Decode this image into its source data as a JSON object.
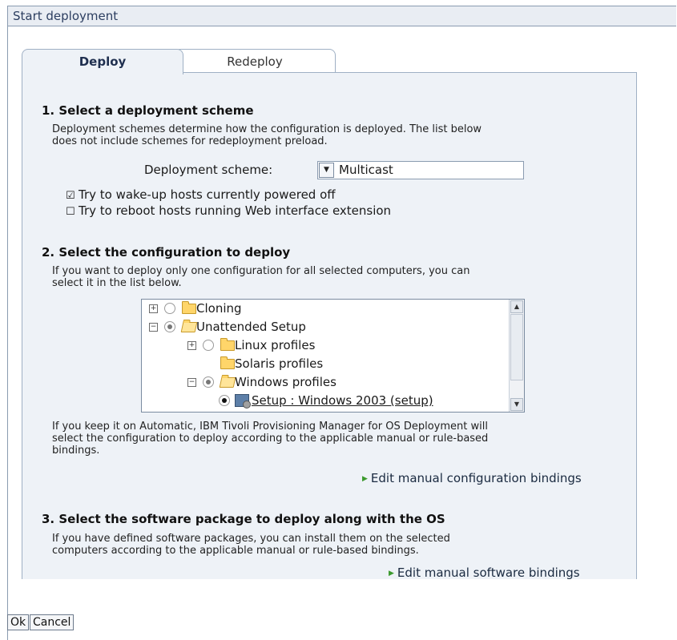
{
  "window": {
    "title": "Start deployment"
  },
  "tabs": [
    {
      "label": "Deploy",
      "active": true
    },
    {
      "label": "Redeploy",
      "active": false
    }
  ],
  "section1": {
    "title": "1. Select a deployment scheme",
    "desc_line1": "Deployment schemes determine how the configuration is deployed. The list below",
    "desc_line2": "does not include schemes for redeployment preload.",
    "scheme_label": "Deployment scheme:",
    "scheme_value": "Multicast",
    "options": [
      {
        "label": "Try to wake-up hosts currently powered off",
        "checked": true
      },
      {
        "label": "Try to reboot hosts running Web interface extension",
        "checked": false
      }
    ]
  },
  "section2": {
    "title": "2. Select the configuration to deploy",
    "desc_line1": "If you want to deploy only one configuration for all selected computers, you can",
    "desc_line2": "select it in the list below.",
    "tree": [
      {
        "label": "Cloning",
        "level": 0,
        "expander": "+",
        "radio": "none",
        "icon": "folder-icon"
      },
      {
        "label": "Unattended Setup",
        "level": 0,
        "expander": "-",
        "radio": "partial",
        "icon": "folder-open-icon"
      },
      {
        "label": "Linux profiles",
        "level": 1,
        "expander": "+",
        "radio": "none",
        "icon": "folder-icon"
      },
      {
        "label": "Solaris profiles",
        "level": 1,
        "expander": "",
        "radio": "",
        "icon": "folder-icon"
      },
      {
        "label": "Windows profiles",
        "level": 1,
        "expander": "-",
        "radio": "partial",
        "icon": "folder-open-icon"
      },
      {
        "label": "Setup : Windows 2003 (setup)",
        "level": 2,
        "expander": "",
        "radio": "selected",
        "icon": "setup-icon"
      }
    ],
    "note_line1": "If you keep it on Automatic, IBM Tivoli Provisioning Manager for OS Deployment will",
    "note_line2": "select the configuration to deploy according to the applicable manual or rule-based",
    "note_line3": "bindings.",
    "link": "Edit manual configuration bindings"
  },
  "section3": {
    "title": "3. Select the software package to deploy along with the OS",
    "desc_line1": "If you have defined software packages, you can install them on the selected",
    "desc_line2": "computers according to the applicable manual or rule-based bindings.",
    "link": "Edit manual software bindings"
  },
  "buttons": {
    "ok": "Ok",
    "cancel": "Cancel"
  },
  "colors": {
    "panel": "#eef2f7",
    "border": "#9fb0c4",
    "link_arrow": "#3c9a2e"
  }
}
